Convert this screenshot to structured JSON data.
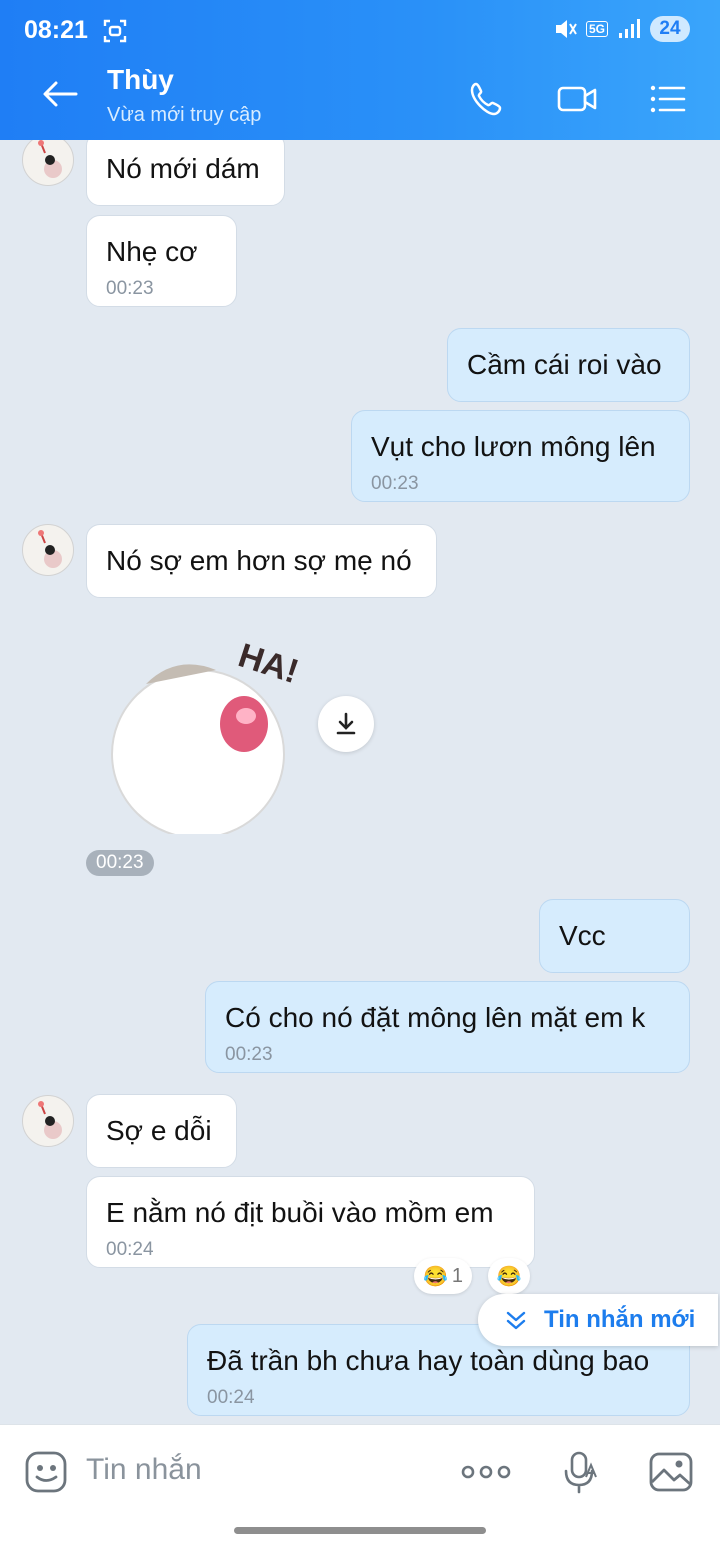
{
  "status_bar": {
    "time": "08:21",
    "network": "5G",
    "battery": "24"
  },
  "header": {
    "name": "Thùy",
    "status": "Vừa mới truy cập"
  },
  "messages": [
    {
      "dir": "in",
      "text": "Nó mới dám"
    },
    {
      "dir": "in",
      "text": "Nhẹ cơ",
      "time": "00:23"
    },
    {
      "dir": "out",
      "text": "Cầm cái roi vào"
    },
    {
      "dir": "out",
      "text": "Vụt cho lươn mông lên",
      "time": "00:23"
    },
    {
      "dir": "in",
      "text": "Nó sợ em hơn sợ mẹ nó"
    },
    {
      "dir": "out",
      "text": "Vcc"
    },
    {
      "dir": "out",
      "text": "Có cho nó đặt mông lên mặt em k",
      "time": "00:23"
    },
    {
      "dir": "in",
      "text": "Sợ e dỗi"
    },
    {
      "dir": "in",
      "text": "E nằm nó địt buồi vào mồm em",
      "time": "00:24"
    },
    {
      "dir": "out",
      "text": "Đã trần bh chưa hay toàn dùng bao",
      "time": "00:24"
    }
  ],
  "sticker": {
    "text": "HA!",
    "time": "00:23"
  },
  "reaction": {
    "count": "1"
  },
  "new_messages_label": "Tin nhắn mới",
  "composer": {
    "placeholder": "Tin nhắn"
  },
  "colors": {
    "header": "#1f7ef5",
    "chat_bg": "#e2e9f1",
    "out_bubble": "#d6ecfd",
    "in_bubble": "#ffffff",
    "accent": "#1d7ded"
  },
  "icons": [
    "back-arrow-icon",
    "phone-icon",
    "video-call-icon",
    "menu-list-icon",
    "sticker-emoji-icon",
    "more-dots-icon",
    "voice-mic-icon",
    "image-icon",
    "download-icon",
    "chevron-double-down-icon"
  ]
}
